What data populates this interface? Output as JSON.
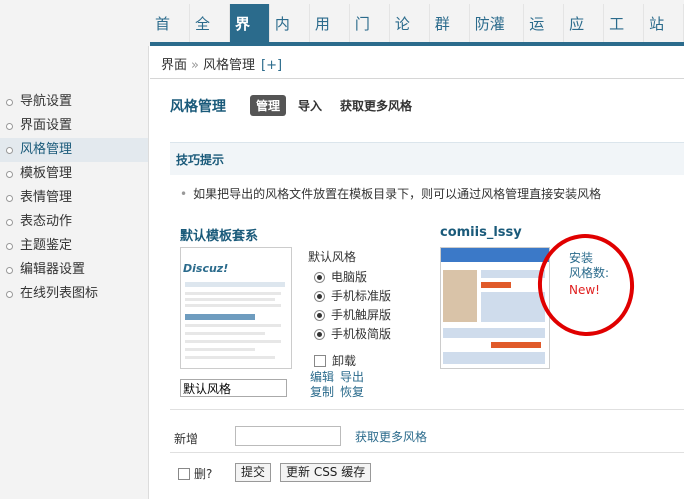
{
  "topnav": {
    "items": [
      "首页",
      "全局",
      "界面",
      "内容",
      "用户",
      "门户",
      "论坛",
      "群组",
      "防灌水",
      "运营",
      "应用",
      "工具",
      "站长"
    ],
    "active_index": 2
  },
  "breadcrumb": {
    "section": "界面",
    "separator": "»",
    "page": "风格管理",
    "add": "[+]"
  },
  "sidebar": {
    "items": [
      "导航设置",
      "界面设置",
      "风格管理",
      "模板管理",
      "表情管理",
      "表态动作",
      "主题鉴定",
      "编辑器设置",
      "在线列表图标"
    ],
    "active_index": 2
  },
  "main": {
    "title": "风格管理",
    "tabs": [
      "管理",
      "导入",
      "获取更多风格"
    ],
    "tips_title": "技巧提示",
    "tip": "如果把导出的风格文件放置在模板目录下，则可以通过风格管理直接安装风格"
  },
  "style1": {
    "title": "默认模板套系",
    "thumb_logo": "Discuz!",
    "options_header": "默认风格",
    "options": [
      "电脑版",
      "手机标准版",
      "手机触屏版",
      "手机极简版"
    ],
    "uninstall_label": "卸载",
    "name_value": "默认风格",
    "links": [
      "编辑",
      "导出",
      "复制",
      "恢复"
    ]
  },
  "style2": {
    "title": "comiis_lssy",
    "install_label": "安装",
    "count_label": "风格数:",
    "new_label": "New!"
  },
  "add": {
    "label": "新增",
    "more_link": "获取更多风格"
  },
  "footer": {
    "delete_label": "删?",
    "submit_label": "提交",
    "update_css_label": "更新 CSS 缓存"
  },
  "colors": {
    "nav_active": "#2b6b8c",
    "annotation_circle": "#e00000",
    "new_badge": "#e02020"
  }
}
